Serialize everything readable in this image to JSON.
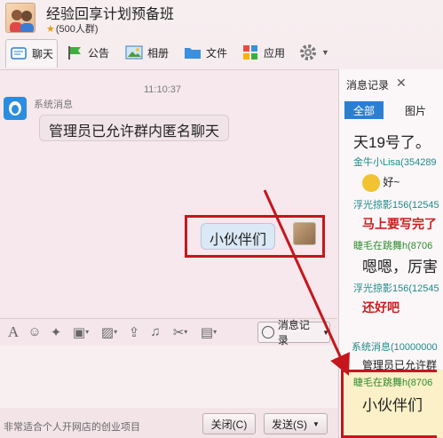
{
  "header": {
    "group_name": "经验回享计划预备班",
    "member_count": "(500人群)"
  },
  "tabs": [
    {
      "label": "聊天",
      "icon": "chat-icon"
    },
    {
      "label": "公告",
      "icon": "announcement-icon"
    },
    {
      "label": "相册",
      "icon": "album-icon"
    },
    {
      "label": "文件",
      "icon": "folder-icon"
    },
    {
      "label": "应用",
      "icon": "apps-icon"
    }
  ],
  "chat": {
    "timestamp": "11:10:37",
    "system_label": "系统消息",
    "system_message": "管理员已允许群内匿名聊天",
    "my_message": "小伙伴们"
  },
  "input_toolbar": {
    "history_label": "消息记录"
  },
  "bottom": {
    "promo": "非常适合个人开网店的创业项目",
    "close_label": "关闭(C)",
    "send_label": "发送(S)"
  },
  "right_panel": {
    "title": "消息记录",
    "close_symbol": "✕",
    "tab_all": "全部",
    "tab_images": "图片",
    "messages": [
      {
        "kind": "text-big",
        "text": "天19号了。"
      },
      {
        "kind": "name",
        "text": "金牛小Lisa(354289"
      },
      {
        "kind": "emoji",
        "text": "好~"
      },
      {
        "kind": "name",
        "text": "浮光掠影156(12545"
      },
      {
        "kind": "text-red",
        "text": "马上要写完了"
      },
      {
        "kind": "name-green",
        "text": "睫毛在跳舞h(8706"
      },
      {
        "kind": "text-big",
        "text": "嗯嗯，厉害"
      },
      {
        "kind": "name",
        "text": "浮光掠影156(12545"
      },
      {
        "kind": "text-red",
        "text": "还好吧"
      },
      {
        "kind": "name",
        "text": "系统消息(10000000"
      },
      {
        "kind": "text-small",
        "text": "管理员已允许群"
      },
      {
        "kind": "name-green",
        "text": "睫毛在跳舞h(8706"
      },
      {
        "kind": "text-big",
        "text": "小伙伴们"
      }
    ]
  },
  "colors": {
    "highlight_red": "#c4161c",
    "active_tab_blue": "#2b7fd3",
    "name_teal": "#1f8a8a"
  }
}
